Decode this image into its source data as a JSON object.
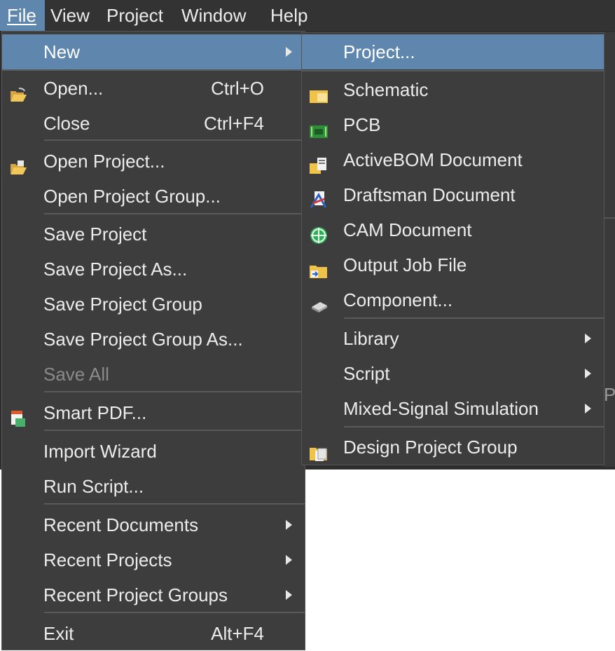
{
  "menubar": {
    "items": [
      "File",
      "View",
      "Project",
      "Window",
      "Help"
    ]
  },
  "file_menu": {
    "new": "New",
    "open": "Open...",
    "open_shortcut": "Ctrl+O",
    "close": "Close",
    "close_shortcut": "Ctrl+F4",
    "open_project": "Open Project...",
    "open_project_group": "Open Project Group...",
    "save_project": "Save Project",
    "save_project_as": "Save Project As...",
    "save_project_group": "Save Project Group",
    "save_project_group_as": "Save Project Group As...",
    "save_all": "Save All",
    "smart_pdf": "Smart PDF...",
    "import_wizard": "Import Wizard",
    "run_script": "Run Script...",
    "recent_documents": "Recent Documents",
    "recent_projects": "Recent Projects",
    "recent_project_groups": "Recent Project Groups",
    "exit": "Exit",
    "exit_shortcut": "Alt+F4"
  },
  "new_submenu": {
    "project": "Project...",
    "schematic": "Schematic",
    "pcb": "PCB",
    "activebom": "ActiveBOM Document",
    "draftsman": "Draftsman Document",
    "cam": "CAM Document",
    "output_job": "Output Job File",
    "component": "Component...",
    "library": "Library",
    "script": "Script",
    "mixed_signal": "Mixed-Signal Simulation",
    "design_project_group": "Design Project Group"
  },
  "background_glyph": "P",
  "colors": {
    "highlight": "#5f86ad",
    "menu_bg": "#3d3d3d",
    "text": "#ececec",
    "disabled": "#8a8a8a"
  },
  "icons": [
    "folder-open-icon",
    "folder-open-icon",
    "smart-pdf-icon",
    "schematic-icon",
    "pcb-icon",
    "activebom-icon",
    "draftsman-icon",
    "cam-icon",
    "output-job-icon",
    "component-icon",
    "design-project-group-icon"
  ]
}
